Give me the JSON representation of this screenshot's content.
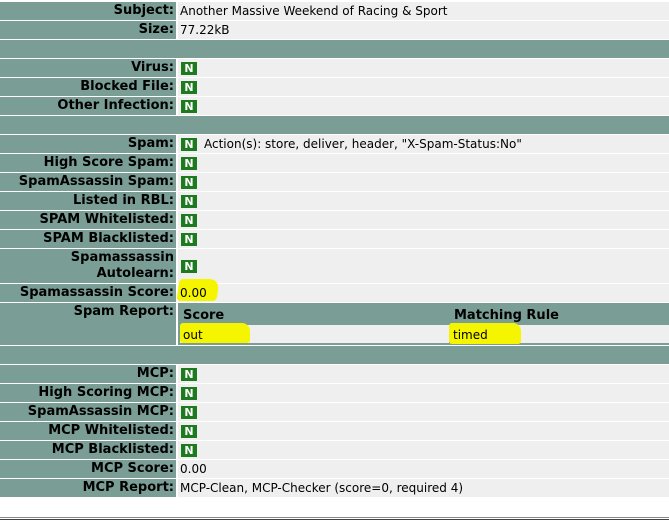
{
  "rows": {
    "subject": {
      "label": "Subject:",
      "value": "Another Massive Weekend of Racing & Sport"
    },
    "size": {
      "label": "Size:",
      "value": "77.22kB"
    },
    "virus": {
      "label": "Virus:",
      "badge": "N"
    },
    "blocked_file": {
      "label": "Blocked File:",
      "badge": "N"
    },
    "other_infection": {
      "label": "Other Infection:",
      "badge": "N"
    },
    "spam": {
      "label": "Spam:",
      "badge": "N",
      "value": "Action(s): store, deliver, header, \"X-Spam-Status:No\""
    },
    "high_score_spam": {
      "label": "High Score Spam:",
      "badge": "N"
    },
    "spamassassin_spam": {
      "label": "SpamAssassin Spam:",
      "badge": "N"
    },
    "listed_in_rbl": {
      "label": "Listed in RBL:",
      "badge": "N"
    },
    "spam_whitelisted": {
      "label": "SPAM Whitelisted:",
      "badge": "N"
    },
    "spam_blacklisted": {
      "label": "SPAM Blacklisted:",
      "badge": "N"
    },
    "spamassassin_autolearn": {
      "label_line1": "Spamassassin",
      "label_line2": "Autolearn:",
      "badge": "N"
    },
    "spamassassin_score": {
      "label": "Spamassassin Score:",
      "value": "0.00"
    },
    "spam_report": {
      "label": "Spam Report:",
      "headers": {
        "score": "Score",
        "matching_rule": "Matching Rule"
      },
      "row": {
        "score": "out",
        "matching_rule": "timed"
      }
    },
    "mcp": {
      "label": "MCP:",
      "badge": "N"
    },
    "high_scoring_mcp": {
      "label": "High Scoring MCP:",
      "badge": "N"
    },
    "spamassassin_mcp": {
      "label": "SpamAssassin MCP:",
      "badge": "N"
    },
    "mcp_whitelisted": {
      "label": "MCP Whitelisted:",
      "badge": "N"
    },
    "mcp_blacklisted": {
      "label": "MCP Blacklisted:",
      "badge": "N"
    },
    "mcp_score": {
      "label": "MCP Score:",
      "value": "0.00"
    },
    "mcp_report": {
      "label": "MCP Report:",
      "value": "MCP-Clean, MCP-Checker (score=0, required 4)"
    }
  },
  "colors": {
    "header_bg": "#7a9e96",
    "value_bg": "#efefef",
    "badge_bg": "#1e7a1e",
    "highlight": "#f5f500"
  }
}
